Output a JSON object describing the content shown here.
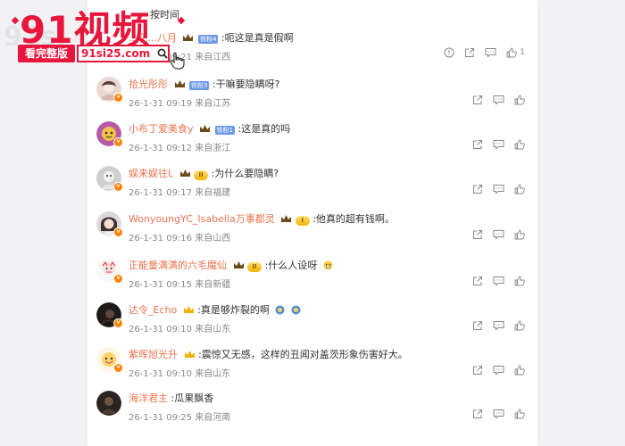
{
  "sort_label": "按时间",
  "banner": {
    "title": "91视频",
    "watermark": "91si",
    "button_label": "看完整版",
    "url": "91si25.com"
  },
  "comments": [
    {
      "username": "...花...八月",
      "badge": "铁粉4",
      "text": ":呃这是真是假啊",
      "date": "26-1-31 09:21",
      "location": "来自江西",
      "like_count": "1"
    },
    {
      "username": "拾光彤彤",
      "badge": "铁粉3",
      "text": ":干嘛要隐瞒呀?",
      "date": "26-1-31 09:19",
      "location": "来自江苏"
    },
    {
      "username": "小布丁爱美食y",
      "badge": "铁粉1",
      "text": ":这是真的吗",
      "date": "26-1-31 09:12",
      "location": "来自浙江"
    },
    {
      "username": "娱来娱往L",
      "badge": "II",
      "text": ":为什么要隐瞒?",
      "date": "26-1-31 09:17",
      "location": "来自福建"
    },
    {
      "username": "WonyoungYC_Isabella万事都灵",
      "badge": "I",
      "text": ":他真的超有钱啊。",
      "date": "26-1-31 09:16",
      "location": "来自山西"
    },
    {
      "username": "正能量满满的六毛魔仙",
      "badge": "II",
      "text": ":什么人设呀",
      "date": "26-1-31 09:15",
      "location": "来自新疆"
    },
    {
      "username": "达令_Echo",
      "badge": "",
      "text": ":真是够炸裂的啊",
      "date": "26-1-31 09:10",
      "location": "来自山东"
    },
    {
      "username": "紫晖旭光升",
      "badge": "",
      "text": ":震惊又无感，这样的丑闻对盖茨形象伤害好大。",
      "date": "26-1-31 09:10",
      "location": "来自山东"
    },
    {
      "username": "海洋君主",
      "badge": "",
      "text": ":瓜果飘香",
      "date": "26-1-31 09:25",
      "location": "来自河南"
    }
  ],
  "colors": {
    "username": "#eb7350",
    "brand_red": "#e8163c",
    "fan_badge": "#6a98e8",
    "meta": "#888888"
  }
}
